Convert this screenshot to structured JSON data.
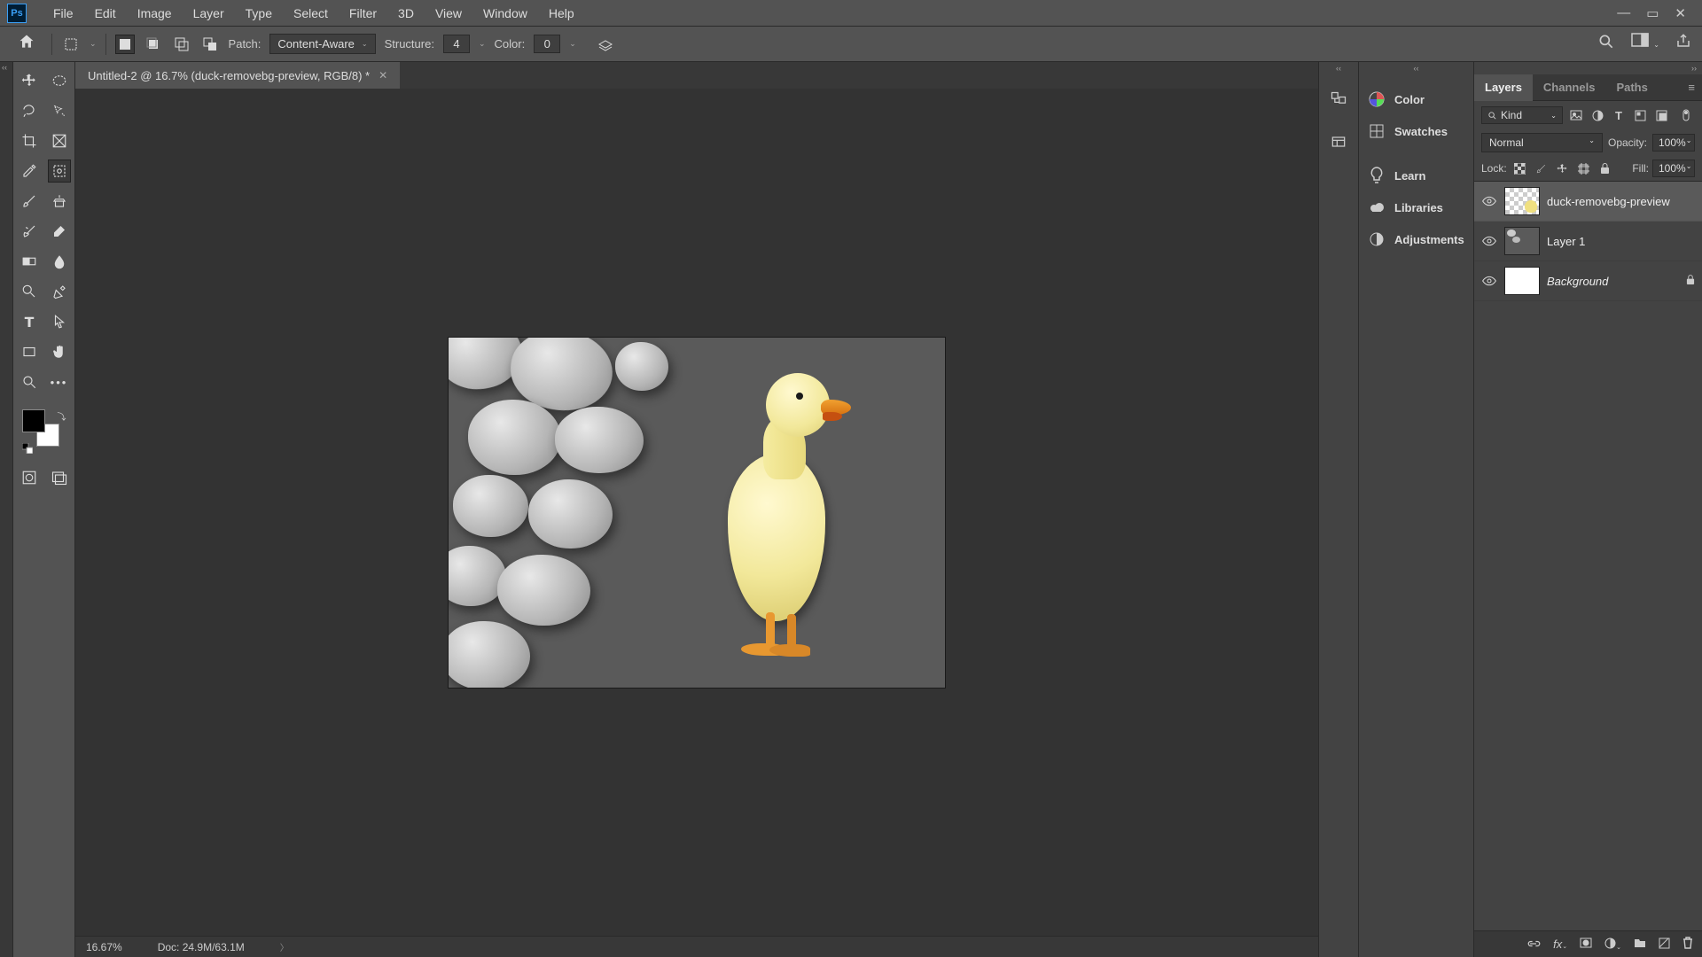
{
  "app": {
    "logo": "Ps"
  },
  "menu": [
    "File",
    "Edit",
    "Image",
    "Layer",
    "Type",
    "Select",
    "Filter",
    "3D",
    "View",
    "Window",
    "Help"
  ],
  "options": {
    "patch_label": "Patch:",
    "patch_value": "Content-Aware",
    "structure_label": "Structure:",
    "structure_value": "4",
    "color_label": "Color:",
    "color_value": "0"
  },
  "document": {
    "tab_title": "Untitled-2 @ 16.7% (duck-removebg-preview, RGB/8) *"
  },
  "status": {
    "zoom": "16.67%",
    "doc": "Doc: 24.9M/63.1M"
  },
  "side_panels": {
    "color": "Color",
    "swatches": "Swatches",
    "learn": "Learn",
    "libraries": "Libraries",
    "adjustments": "Adjustments"
  },
  "layers_panel": {
    "tabs": [
      "Layers",
      "Channels",
      "Paths"
    ],
    "filter_kind": "Kind",
    "blend_mode": "Normal",
    "opacity_label": "Opacity:",
    "opacity_value": "100%",
    "lock_label": "Lock:",
    "fill_label": "Fill:",
    "fill_value": "100%",
    "layers": [
      {
        "name": "duck-removebg-preview",
        "visible": true,
        "locked": false,
        "italic": false,
        "selected": true,
        "thumb": "check"
      },
      {
        "name": "Layer 1",
        "visible": true,
        "locked": false,
        "italic": false,
        "selected": false,
        "thumb": "stones"
      },
      {
        "name": "Background",
        "visible": true,
        "locked": true,
        "italic": true,
        "selected": false,
        "thumb": "white"
      }
    ]
  }
}
